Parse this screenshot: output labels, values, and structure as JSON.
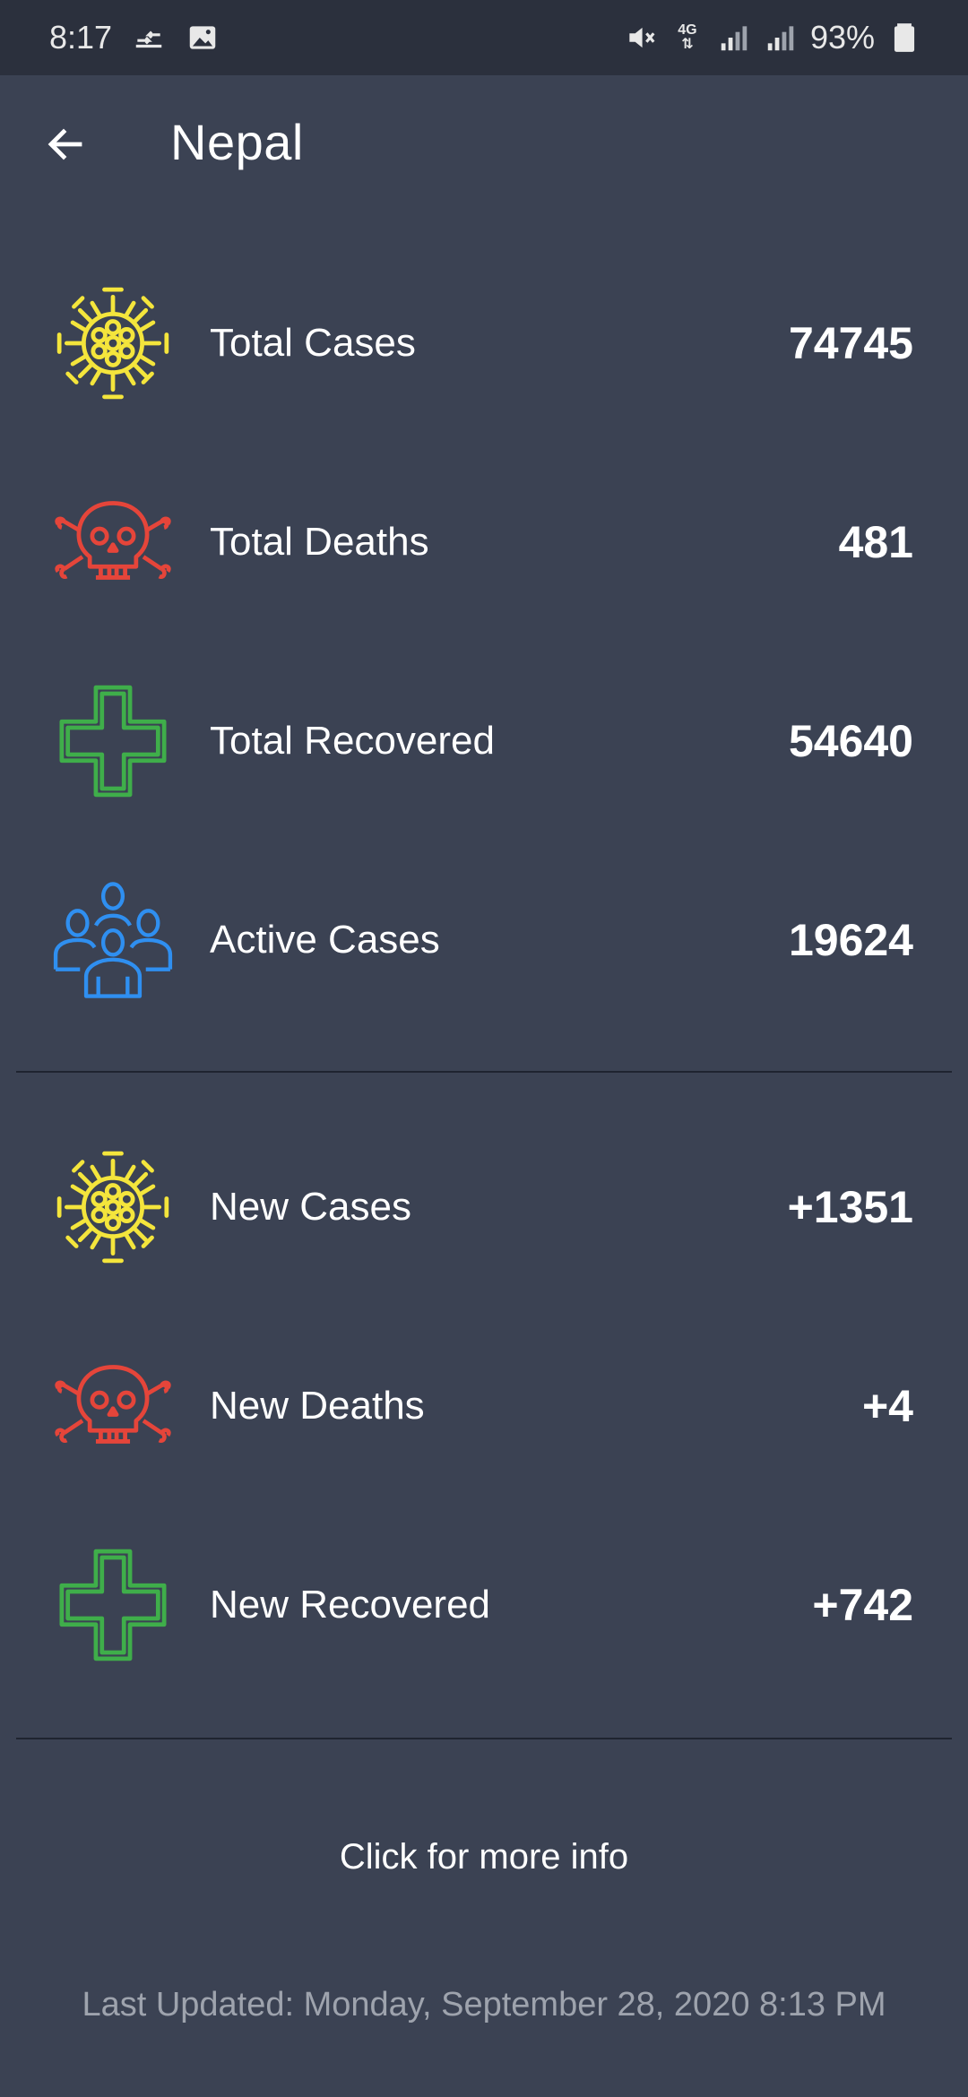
{
  "status_bar": {
    "time": "8:17",
    "battery": "93%",
    "network": "4G"
  },
  "header": {
    "title": "Nepal"
  },
  "stats": {
    "total_cases": {
      "label": "Total Cases",
      "value": "74745",
      "icon": "virus-icon",
      "color": "#f4e53c"
    },
    "total_deaths": {
      "label": "Total Deaths",
      "value": "481",
      "icon": "skull-crossbones-icon",
      "color": "#e5453a"
    },
    "total_recovered": {
      "label": "Total Recovered",
      "value": "54640",
      "icon": "medical-cross-icon",
      "color": "#3fae4a"
    },
    "active_cases": {
      "label": "Active Cases",
      "value": "19624",
      "icon": "people-group-icon",
      "color": "#2f8ff0"
    },
    "new_cases": {
      "label": "New Cases",
      "value": "+1351",
      "icon": "virus-icon",
      "color": "#f4e53c"
    },
    "new_deaths": {
      "label": "New Deaths",
      "value": "+4",
      "icon": "skull-crossbones-icon",
      "color": "#e5453a"
    },
    "new_recovered": {
      "label": "New Recovered",
      "value": "+742",
      "icon": "medical-cross-icon",
      "color": "#3fae4a"
    }
  },
  "footer": {
    "more_info": "Click for more info",
    "last_updated": "Last Updated: Monday, September 28, 2020  8:13 PM"
  }
}
